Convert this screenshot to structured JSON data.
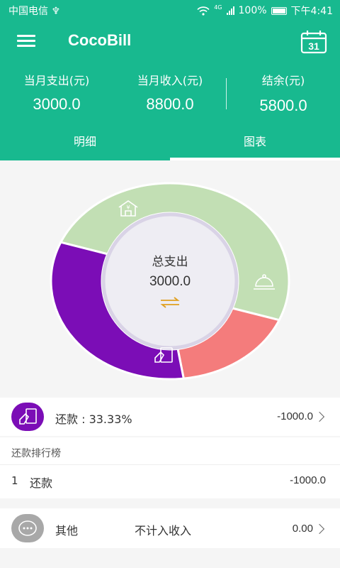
{
  "status_bar": {
    "carrier": "中国电信 ♆",
    "network": "4G",
    "battery": "100%",
    "time": "下午4:41"
  },
  "app": {
    "title": "CocoBill",
    "calendar_day": "31"
  },
  "summary": [
    {
      "label": "当月支出(元)",
      "value": "3000.0"
    },
    {
      "label": "当月收入(元)",
      "value": "8800.0"
    },
    {
      "label": "结余(元)",
      "value": "5800.0"
    }
  ],
  "tabs": [
    {
      "label": "明细"
    },
    {
      "label": "图表"
    }
  ],
  "active_tab": 1,
  "donut": {
    "center_title": "总支出",
    "center_value": "3000.0",
    "slices": [
      {
        "category": "housing",
        "icon": "house-icon",
        "color": "#c2dfb4",
        "fraction": 0.5
      },
      {
        "category": "dining",
        "icon": "food-cloche-icon",
        "color": "#f47c7c",
        "fraction": 0.1667
      },
      {
        "category": "repayment",
        "icon": "card-hand-icon",
        "color": "#7b0db6",
        "fraction": 0.3333
      }
    ],
    "colors": {
      "center_fill": "#eeedf3",
      "swap_icon": "#e0a020"
    }
  },
  "selected_category": {
    "label": "还款 : 33.33%",
    "amount": "-1000.0",
    "color": "#7b0db6"
  },
  "ranking": {
    "title": "还款排行榜",
    "items": [
      {
        "rank": "1",
        "name": "还款",
        "amount": "-1000.0"
      }
    ]
  },
  "other": {
    "name": "其他",
    "note": "不计入收入",
    "amount": "0.00",
    "color": "#a8a8a8"
  }
}
